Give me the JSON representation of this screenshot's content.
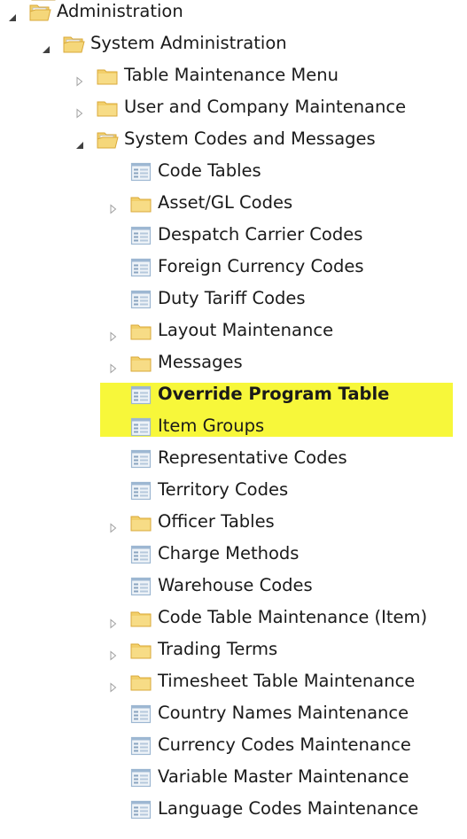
{
  "tree": {
    "items": [
      {
        "label": "Administration",
        "type": "folder-open",
        "level": 0,
        "expander": "expanded"
      },
      {
        "label": "System Administration",
        "type": "folder-open",
        "level": 1,
        "expander": "expanded"
      },
      {
        "label": "Table Maintenance Menu",
        "type": "folder",
        "level": 2,
        "expander": "collapsed"
      },
      {
        "label": "User and Company Maintenance",
        "type": "folder",
        "level": 2,
        "expander": "collapsed"
      },
      {
        "label": "System Codes and Messages",
        "type": "folder-open",
        "level": 2,
        "expander": "expanded"
      },
      {
        "label": "Code Tables",
        "type": "form",
        "level": 3,
        "expander": "none"
      },
      {
        "label": "Asset/GL Codes",
        "type": "folder",
        "level": 3,
        "expander": "collapsed"
      },
      {
        "label": "Despatch Carrier Codes",
        "type": "form",
        "level": 3,
        "expander": "none"
      },
      {
        "label": "Foreign Currency Codes",
        "type": "form",
        "level": 3,
        "expander": "none"
      },
      {
        "label": "Duty Tariff Codes",
        "type": "form",
        "level": 3,
        "expander": "none"
      },
      {
        "label": "Layout Maintenance",
        "type": "folder",
        "level": 3,
        "expander": "collapsed"
      },
      {
        "label": "Messages",
        "type": "folder",
        "level": 3,
        "expander": "collapsed"
      },
      {
        "label": "Override Program Table",
        "type": "form",
        "level": 3,
        "expander": "none",
        "highlighted": true
      },
      {
        "label": "Item Groups",
        "type": "form",
        "level": 3,
        "expander": "none"
      },
      {
        "label": "Representative Codes",
        "type": "form",
        "level": 3,
        "expander": "none"
      },
      {
        "label": "Territory Codes",
        "type": "form",
        "level": 3,
        "expander": "none"
      },
      {
        "label": "Officer Tables",
        "type": "folder",
        "level": 3,
        "expander": "collapsed"
      },
      {
        "label": "Charge Methods",
        "type": "form",
        "level": 3,
        "expander": "none"
      },
      {
        "label": "Warehouse Codes",
        "type": "form",
        "level": 3,
        "expander": "none"
      },
      {
        "label": "Code Table Maintenance (Item)",
        "type": "folder",
        "level": 3,
        "expander": "collapsed"
      },
      {
        "label": "Trading Terms",
        "type": "folder",
        "level": 3,
        "expander": "collapsed"
      },
      {
        "label": "Timesheet Table Maintenance",
        "type": "folder",
        "level": 3,
        "expander": "collapsed"
      },
      {
        "label": "Country Names Maintenance",
        "type": "form",
        "level": 3,
        "expander": "none"
      },
      {
        "label": "Currency Codes Maintenance",
        "type": "form",
        "level": 3,
        "expander": "none"
      },
      {
        "label": "Variable Master Maintenance",
        "type": "form",
        "level": 3,
        "expander": "none"
      },
      {
        "label": "Language Codes Maintenance",
        "type": "form",
        "level": 3,
        "expander": "none"
      }
    ]
  },
  "colors": {
    "highlight": "#f7f73a",
    "folder": "#f2cf6a",
    "folder_dark": "#d9a93a",
    "form_blue": "#9db7d2",
    "expander_gray": "#a0a0a0",
    "expander_dark": "#404040"
  }
}
